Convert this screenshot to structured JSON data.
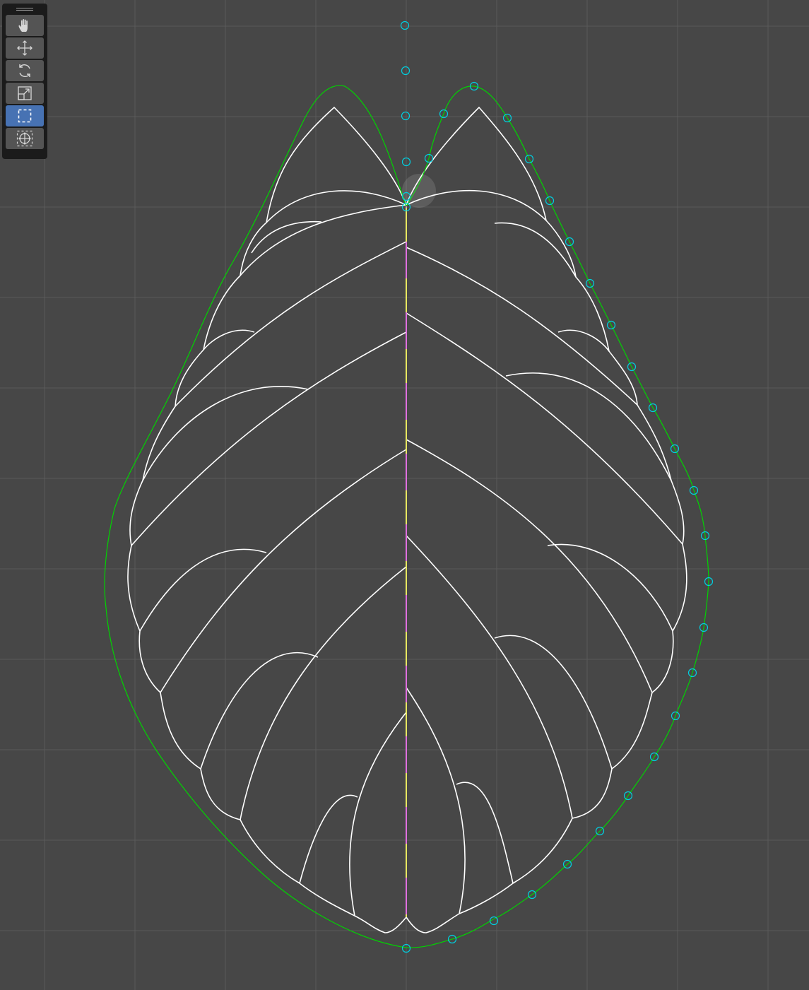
{
  "toolbar": {
    "tools": [
      {
        "name": "tool-view",
        "icon": "hand-icon",
        "active": false
      },
      {
        "name": "tool-move",
        "icon": "move-arrows-icon",
        "active": false
      },
      {
        "name": "tool-rotate",
        "icon": "rotate-icon",
        "active": false
      },
      {
        "name": "tool-scale",
        "icon": "scale-icon",
        "active": false
      },
      {
        "name": "tool-select-box",
        "icon": "select-box-icon",
        "active": true
      },
      {
        "name": "tool-transform",
        "icon": "transform-icon",
        "active": false
      }
    ]
  },
  "colors": {
    "background": "#474747",
    "grid": "#5a5a5a",
    "outline": "#00d400",
    "handles": "#00cfe0",
    "veins": "#ffffff",
    "midrib_a": "#e8e860",
    "midrib_b": "#e070e0",
    "active_tool": "#4772b3"
  }
}
